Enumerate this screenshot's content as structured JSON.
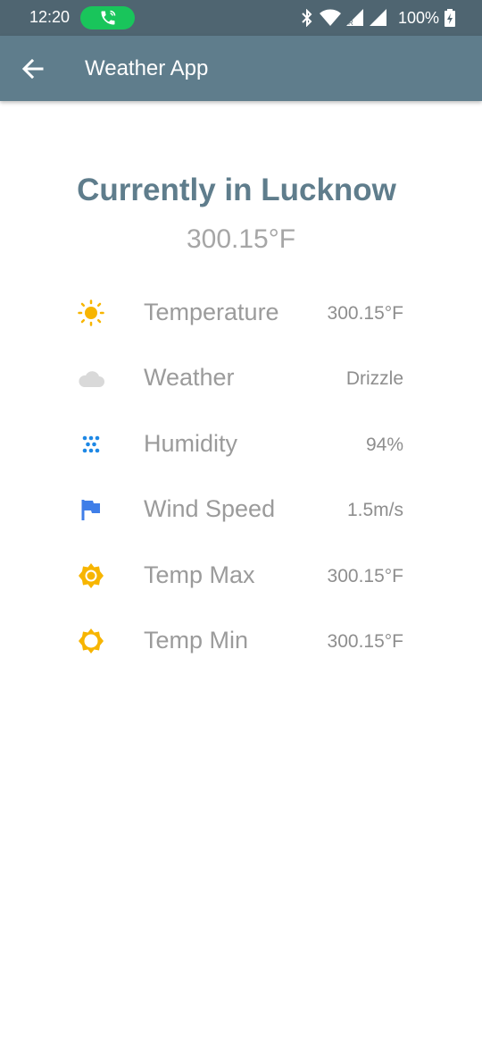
{
  "status_bar": {
    "time": "12:20",
    "battery": "100%",
    "icons": [
      "call-icon",
      "bluetooth-icon",
      "wifi-icon",
      "signal-r-icon",
      "signal-icon",
      "battery-charging-icon"
    ]
  },
  "app_bar": {
    "title": "Weather App",
    "back_icon": "arrow-back-icon"
  },
  "main": {
    "headline": "Currently in Lucknow",
    "current_temp": "300.15°F",
    "details": [
      {
        "label": "Temperature",
        "value": "300.15°F",
        "icon": "sun-icon",
        "color": "#f7b500"
      },
      {
        "label": "Weather",
        "value": "Drizzle",
        "icon": "cloud-icon",
        "color": "#d9d9d9"
      },
      {
        "label": "Humidity",
        "value": "94%",
        "icon": "humidity-dots-icon",
        "color": "#1e88e5"
      },
      {
        "label": "Wind Speed",
        "value": "1.5m/s",
        "icon": "flag-icon",
        "color": "#3f7ee8"
      },
      {
        "label": "Temp Max",
        "value": "300.15°F",
        "icon": "sun-max-icon",
        "color": "#f7b500"
      },
      {
        "label": "Temp Min",
        "value": "300.15°F",
        "icon": "sun-min-icon",
        "color": "#f7b500"
      }
    ]
  },
  "colors": {
    "status_bar": "#4f6571",
    "app_bar": "#5f7d8c",
    "headline": "#5f7d8c",
    "call_pill": "#19c55b"
  }
}
